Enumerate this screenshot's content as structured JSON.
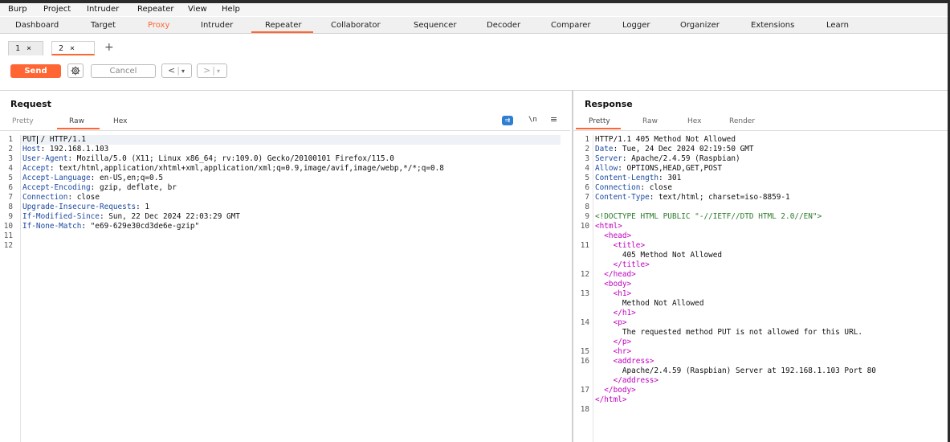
{
  "menu": [
    "Burp",
    "Project",
    "Intruder",
    "Repeater",
    "View",
    "Help"
  ],
  "tool_tabs": [
    "Dashboard",
    "Target",
    "Proxy",
    "Intruder",
    "Repeater",
    "Collaborator",
    "Sequencer",
    "Decoder",
    "Comparer",
    "Logger",
    "Organizer",
    "Extensions",
    "Learn"
  ],
  "active_tool_tab": "Repeater",
  "colors": {
    "accent": "#ff6633",
    "header_key": "#1d4aa1",
    "tag": "#c000c0",
    "doctype": "#2b7a2b"
  },
  "subtabs": [
    {
      "label": "1",
      "close": "×"
    },
    {
      "label": "2",
      "close": "×"
    }
  ],
  "new_tab": "+",
  "toolbar": {
    "send": "Send",
    "settings_icon": "gear-icon",
    "cancel": "Cancel",
    "back": "<",
    "forward": ">",
    "dropdown": "▾"
  },
  "request": {
    "title": "Request",
    "tabs": [
      "Pretty",
      "Raw",
      "Hex"
    ],
    "active_tab": "Raw",
    "icons": {
      "wrap": "wrap-icon",
      "newline": "\\n",
      "menu": "≡"
    },
    "lines": [
      {
        "n": "1",
        "key": "",
        "val": "PUT / HTTP/1.1"
      },
      {
        "n": "2",
        "key": "Host",
        "val": ": 192.168.1.103"
      },
      {
        "n": "3",
        "key": "User-Agent",
        "val": ": Mozilla/5.0 (X11; Linux x86_64; rv:109.0) Gecko/20100101 Firefox/115.0"
      },
      {
        "n": "4",
        "key": "Accept",
        "val": ": text/html,application/xhtml+xml,application/xml;q=0.9,image/avif,image/webp,*/*;q=0.8"
      },
      {
        "n": "5",
        "key": "Accept-Language",
        "val": ": en-US,en;q=0.5"
      },
      {
        "n": "6",
        "key": "Accept-Encoding",
        "val": ": gzip, deflate, br"
      },
      {
        "n": "7",
        "key": "Connection",
        "val": ": close"
      },
      {
        "n": "8",
        "key": "Upgrade-Insecure-Requests",
        "val": ": 1"
      },
      {
        "n": "9",
        "key": "If-Modified-Since",
        "val": ": Sun, 22 Dec 2024 22:03:29 GMT"
      },
      {
        "n": "10",
        "key": "If-None-Match",
        "val": ": \"e69-629e30cd3de6e-gzip\""
      },
      {
        "n": "11",
        "key": "",
        "val": ""
      },
      {
        "n": "12",
        "key": "",
        "val": ""
      }
    ]
  },
  "response": {
    "title": "Response",
    "tabs": [
      "Pretty",
      "Raw",
      "Hex",
      "Render"
    ],
    "active_tab": "Pretty",
    "lines": [
      {
        "n": "1",
        "t": "plain",
        "text": "HTTP/1.1 405 Method Not Allowed"
      },
      {
        "n": "2",
        "t": "hdr",
        "key": "Date",
        "text": ": Tue, 24 Dec 2024 02:19:50 GMT"
      },
      {
        "n": "3",
        "t": "hdr",
        "key": "Server",
        "text": ": Apache/2.4.59 (Raspbian)"
      },
      {
        "n": "4",
        "t": "hdr",
        "key": "Allow",
        "text": ": OPTIONS,HEAD,GET,POST"
      },
      {
        "n": "5",
        "t": "hdr",
        "key": "Content-Length",
        "text": ": 301"
      },
      {
        "n": "6",
        "t": "hdr",
        "key": "Connection",
        "text": ": close"
      },
      {
        "n": "7",
        "t": "hdr",
        "key": "Content-Type",
        "text": ": text/html; charset=iso-8859-1"
      },
      {
        "n": "8",
        "t": "plain",
        "text": ""
      },
      {
        "n": "9",
        "t": "doctype",
        "text": "<!DOCTYPE HTML PUBLIC \"-//IETF//DTD HTML 2.0//EN\">"
      },
      {
        "n": "10",
        "t": "tag",
        "text": "<html>"
      },
      {
        "n": "",
        "t": "tag",
        "text": "  <head>"
      },
      {
        "n": "11",
        "t": "tag",
        "text": "    <title>"
      },
      {
        "n": "",
        "t": "plain",
        "text": "      405 Method Not Allowed"
      },
      {
        "n": "",
        "t": "tag",
        "text": "    </title>"
      },
      {
        "n": "12",
        "t": "tag",
        "text": "  </head>"
      },
      {
        "n": "",
        "t": "tag",
        "text": "  <body>"
      },
      {
        "n": "13",
        "t": "tag",
        "text": "    <h1>"
      },
      {
        "n": "",
        "t": "plain",
        "text": "      Method Not Allowed"
      },
      {
        "n": "",
        "t": "tag",
        "text": "    </h1>"
      },
      {
        "n": "14",
        "t": "tag",
        "text": "    <p>"
      },
      {
        "n": "",
        "t": "plain",
        "text": "      The requested method PUT is not allowed for this URL."
      },
      {
        "n": "",
        "t": "tag",
        "text": "    </p>"
      },
      {
        "n": "15",
        "t": "tag",
        "text": "    <hr>"
      },
      {
        "n": "16",
        "t": "tag",
        "text": "    <address>"
      },
      {
        "n": "",
        "t": "plain",
        "text": "      Apache/2.4.59 (Raspbian) Server at 192.168.1.103 Port 80"
      },
      {
        "n": "",
        "t": "tag",
        "text": "    </address>"
      },
      {
        "n": "17",
        "t": "tag",
        "text": "  </body>"
      },
      {
        "n": "",
        "t": "tag",
        "text": "</html>"
      },
      {
        "n": "18",
        "t": "plain",
        "text": ""
      }
    ]
  }
}
